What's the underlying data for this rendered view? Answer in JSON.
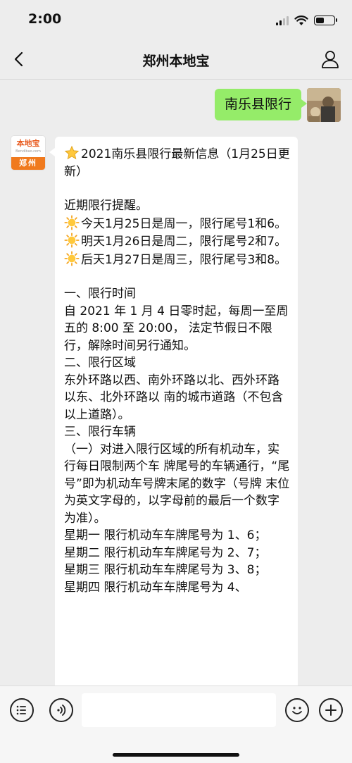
{
  "status_bar": {
    "time": "2:00"
  },
  "nav": {
    "title": "郑州本地宝"
  },
  "chat": {
    "outgoing_message": "南乐县限行",
    "bot_avatar": {
      "brand": "本地宝",
      "domain": "Bendibao.com",
      "city": "郑州"
    },
    "incoming_lines": [
      {
        "icon": "star",
        "text": "2021南乐县限行最新信息（1月25日更新）"
      },
      {
        "gap": true
      },
      {
        "text": "近期限行提醒。"
      },
      {
        "icon": "sun",
        "text": "今天1月25日是周一，限行尾号1和6。"
      },
      {
        "icon": "sun",
        "text": "明天1月26日是周二，限行尾号2和7。"
      },
      {
        "icon": "sun",
        "text": "后天1月27日是周三，限行尾号3和8。"
      },
      {
        "gap": true
      },
      {
        "text": "一、限行时间"
      },
      {
        "text": "自 2021 年 1 月 4 日零时起，每周一至周五的 8:00 至 20:00， 法定节假日不限行，解除时间另行通知。"
      },
      {
        "text": "二、限行区域"
      },
      {
        "text": "东外环路以西、南外环路以北、西外环路以东、北外环路以 南的城市道路（不包含以上道路）。"
      },
      {
        "text": "三、限行车辆"
      },
      {
        "text": "（一）对进入限行区域的所有机动车，实行每日限制两个车 牌尾号的车辆通行，“尾号”即为机动车号牌末尾的数字（号牌 末位为英文字母的，以字母前的最后一个数字为准）。"
      },
      {
        "text": "星期一 限行机动车车牌尾号为 1、6；"
      },
      {
        "text": "星期二 限行机动车车牌尾号为 2、7；"
      },
      {
        "text": "星期三 限行机动车车牌尾号为 3、8；"
      },
      {
        "text": "星期四 限行机动车车牌尾号为 4、"
      }
    ]
  },
  "input": {
    "placeholder": ""
  },
  "icons": {
    "back": "chevron-left-icon",
    "profile": "person-icon",
    "menu": "list-icon",
    "voice": "voice-icon",
    "emoji": "smiley-icon",
    "add": "plus-icon"
  },
  "colors": {
    "outgoing_bubble": "#95ec69",
    "background": "#ededed",
    "bot_brand": "#f07a1e"
  }
}
